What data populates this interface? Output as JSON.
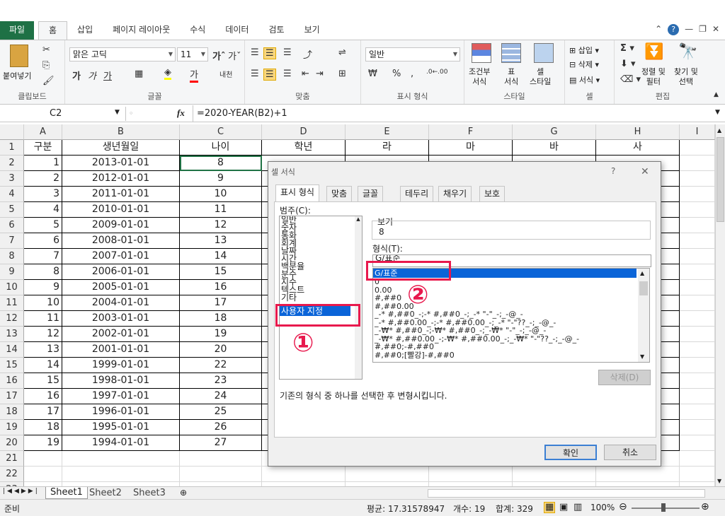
{
  "tabs": [
    "파일",
    "홈",
    "삽입",
    "페이지 레이아웃",
    "수식",
    "데이터",
    "검토",
    "보기"
  ],
  "ribbon": {
    "paste": "붙여넣기",
    "clipboard": "클립보드",
    "font_name": "맑은 고딕",
    "font_size": "11",
    "font_group": "글꼴",
    "align_group": "맞춤",
    "number_format": "일반",
    "number_group": "표시 형식",
    "cond_format": "조건부\n서식",
    "table_format": "표\n서식",
    "cell_style": "셀\n스타일",
    "style_group": "스타일",
    "insert": "삽입",
    "delete": "삭제",
    "format": "서식",
    "cells_group": "셀",
    "sort": "정렬 및\n필터",
    "find": "찾기 및\n선택",
    "edit_group": "편집"
  },
  "formula_bar": {
    "name_box": "C2",
    "fx": "fx",
    "formula": "=2020-YEAR(B2)+1"
  },
  "columns": [
    "A",
    "B",
    "C",
    "D",
    "E",
    "F",
    "G",
    "H",
    "I"
  ],
  "header_row": [
    "구분",
    "생년월일",
    "나이",
    "학년",
    "라",
    "마",
    "바",
    "사"
  ],
  "rows": [
    [
      "1",
      "2013-01-01",
      "8"
    ],
    [
      "2",
      "2012-01-01",
      "9"
    ],
    [
      "3",
      "2011-01-01",
      "10"
    ],
    [
      "4",
      "2010-01-01",
      "11"
    ],
    [
      "5",
      "2009-01-01",
      "12"
    ],
    [
      "6",
      "2008-01-01",
      "13"
    ],
    [
      "7",
      "2007-01-01",
      "14"
    ],
    [
      "8",
      "2006-01-01",
      "15"
    ],
    [
      "9",
      "2005-01-01",
      "16"
    ],
    [
      "10",
      "2004-01-01",
      "17"
    ],
    [
      "11",
      "2003-01-01",
      "18"
    ],
    [
      "12",
      "2002-01-01",
      "19"
    ],
    [
      "13",
      "2001-01-01",
      "20"
    ],
    [
      "14",
      "1999-01-01",
      "22"
    ],
    [
      "15",
      "1998-01-01",
      "23"
    ],
    [
      "16",
      "1997-01-01",
      "24"
    ],
    [
      "17",
      "1996-01-01",
      "25"
    ],
    [
      "18",
      "1995-01-01",
      "26"
    ],
    [
      "19",
      "1994-01-01",
      "27"
    ]
  ],
  "row_numbers": [
    "1",
    "2",
    "3",
    "4",
    "5",
    "6",
    "7",
    "8",
    "9",
    "10",
    "11",
    "12",
    "13",
    "14",
    "15",
    "16",
    "17",
    "18",
    "19",
    "20",
    "21",
    "22",
    "23"
  ],
  "sheets": [
    "Sheet1",
    "Sheet2",
    "Sheet3"
  ],
  "status": {
    "ready": "준비",
    "average": "평균: 17.31578947",
    "count": "개수: 19",
    "sum": "합계: 329",
    "zoom": "100%"
  },
  "dialog": {
    "title": "셀 서식",
    "help": "?",
    "close": "✕",
    "tabs": [
      "표시 형식",
      "맞춤",
      "글꼴",
      "테두리",
      "채우기",
      "보호"
    ],
    "category_label": "범주(C):",
    "categories": [
      "일반",
      "숫자",
      "통화",
      "회계",
      "날짜",
      "시간",
      "백분율",
      "분수",
      "지수",
      "텍스트",
      "기타",
      "사용자 지정"
    ],
    "sample_label": "보기",
    "sample_value": "8",
    "type_label": "형식(T):",
    "type_value": "G/표준",
    "formats": [
      "G/표준",
      "0",
      "0.00",
      "#,##0",
      "#,##0.00",
      "_-* #,##0_-;-* #,##0_-;_-* \"-\"_-;_-@_-",
      "_-* #,##0.00_-;-* #,##0.00_-;_-* \"-\"??_-;_-@_-",
      "_-₩* #,##0_-;-₩* #,##0_-;_-₩* \"-\"_-;_-@_-",
      "_-₩* #,##0.00_-;-₩* #,##0.00_-;_-₩* \"-\"??_-;_-@_-",
      "#,##0;-#,##0",
      "#,##0;[빨강]-#,##0"
    ],
    "delete": "삭제(D)",
    "description": "기존의 형식 중 하나를 선택한 후 변형시킵니다.",
    "ok": "확인",
    "cancel": "취소",
    "marker1": "①",
    "marker2": "②"
  }
}
